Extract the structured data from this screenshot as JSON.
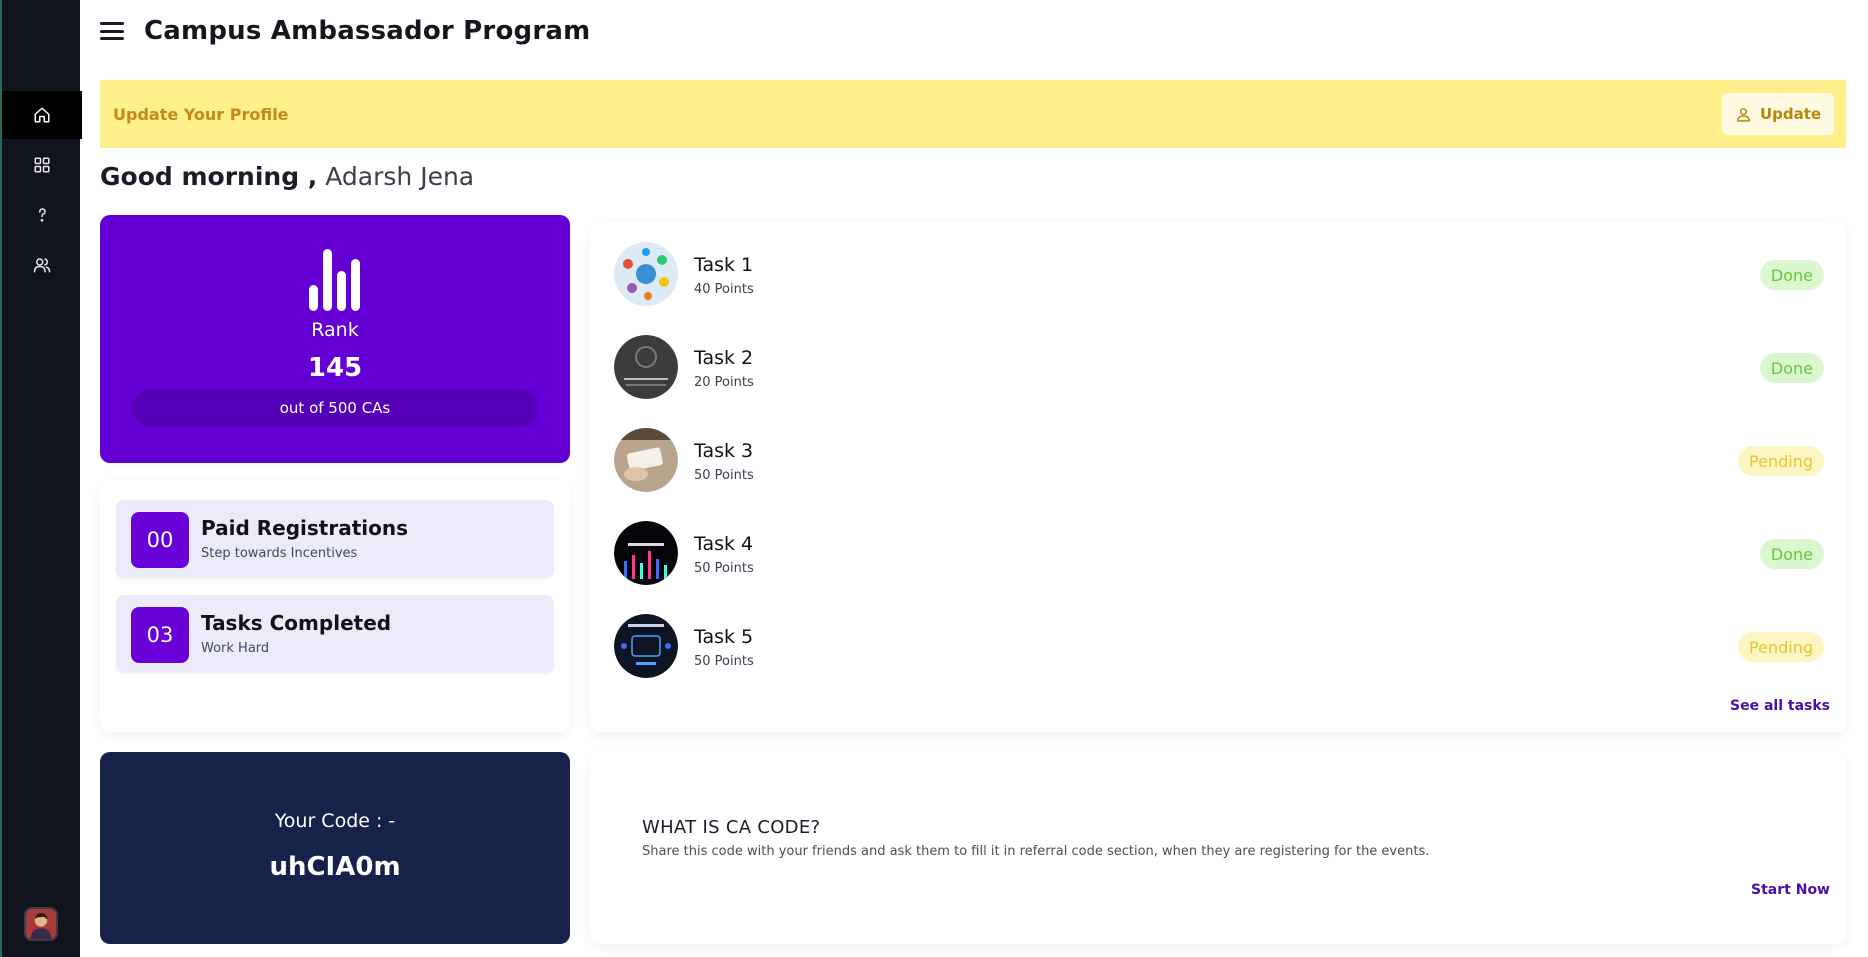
{
  "header": {
    "title": "Campus Ambassador Program"
  },
  "sidebar": {
    "items": [
      {
        "icon": "home-icon"
      },
      {
        "icon": "grid-icon"
      },
      {
        "icon": "help-icon"
      },
      {
        "icon": "users-icon"
      }
    ],
    "avatar": "user-avatar"
  },
  "banner": {
    "text": "Update Your Profile",
    "button_label": "Update",
    "color": "#fef08a"
  },
  "greeting": {
    "salutation": "Good morning ,",
    "name": "Adarsh Jena"
  },
  "rank": {
    "label": "Rank",
    "value": "145",
    "caption": "out of 500 CAs",
    "color": "#6400d6"
  },
  "stats": [
    {
      "number": "00",
      "title": "Paid Registrations",
      "subtitle": "Step towards Incentives"
    },
    {
      "number": "03",
      "title": "Tasks Completed",
      "subtitle": "Work Hard"
    }
  ],
  "tasks": [
    {
      "name": "Task 1",
      "points": "40 Points",
      "status": "Done"
    },
    {
      "name": "Task 2",
      "points": "20 Points",
      "status": "Done"
    },
    {
      "name": "Task 3",
      "points": "50 Points",
      "status": "Pending"
    },
    {
      "name": "Task 4",
      "points": "50 Points",
      "status": "Done"
    },
    {
      "name": "Task 5",
      "points": "50 Points",
      "status": "Pending"
    }
  ],
  "tasks_link": "See all tasks",
  "code": {
    "label": "Your Code : -",
    "value": "uhCIA0m",
    "color": "#16224a"
  },
  "info": {
    "title": "WHAT IS CA CODE?",
    "description": "Share this code with your friends and ask them to fill it in referral code section, when they are registering for the events.",
    "link": "Start Now"
  }
}
